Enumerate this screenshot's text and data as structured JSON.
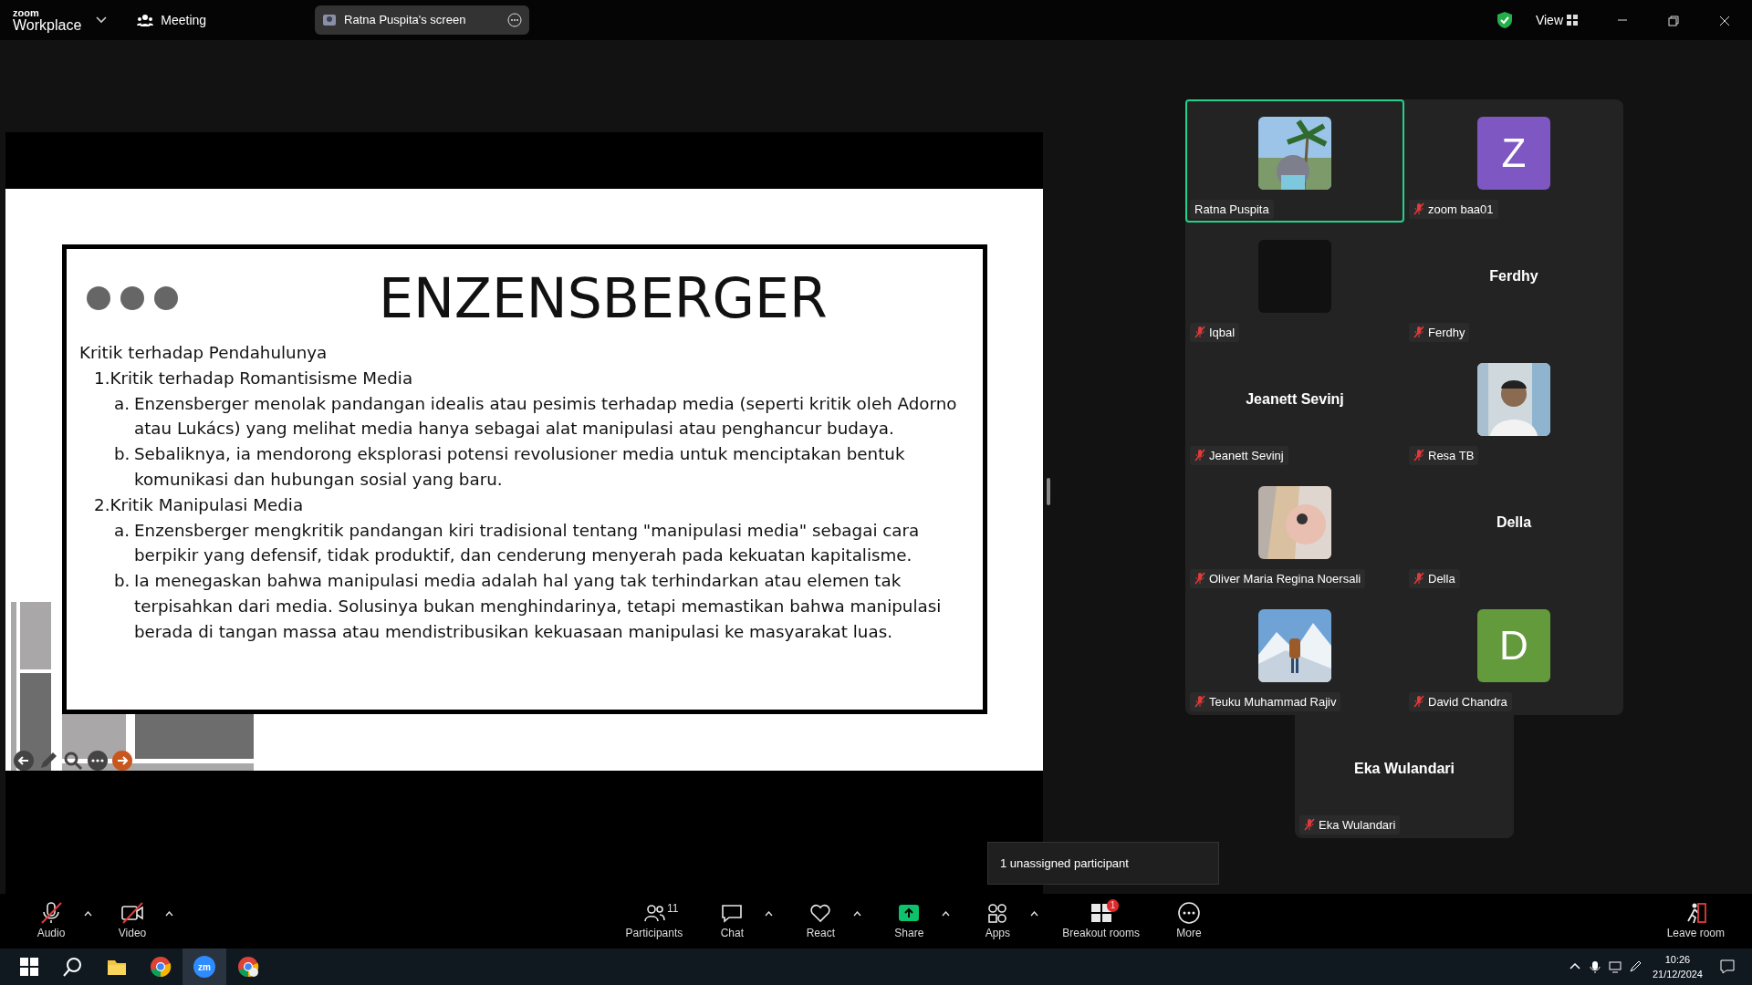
{
  "title_bar": {
    "logo_top": "zoom",
    "logo_bottom": "Workplace",
    "meeting_menu": "Meeting",
    "share_tab": "Ratna Puspita's screen",
    "view_button": "View"
  },
  "slide": {
    "title": "ENZENSBERGER",
    "intro": "Kritik terhadap Pendahulunya",
    "points": [
      {
        "label": "1.Kritik terhadap Romantisisme Media",
        "children": [
          {
            "marker": "a.",
            "text": "Enzensberger menolak pandangan idealis atau pesimis terhadap media (seperti kritik oleh Adorno atau Lukács) yang melihat media hanya sebagai alat manipulasi atau penghancur budaya."
          },
          {
            "marker": "b.",
            "text": "Sebaliknya, ia mendorong eksplorasi potensi revolusioner media untuk menciptakan bentuk komunikasi dan hubungan sosial yang baru."
          }
        ]
      },
      {
        "label": "2.Kritik Manipulasi Media",
        "children": [
          {
            "marker": "a.",
            "text": "Enzensberger mengkritik pandangan kiri tradisional tentang \"manipulasi media\" sebagai cara berpikir yang defensif, tidak produktif, dan cenderung menyerah pada kekuatan kapitalisme."
          },
          {
            "marker": "b.",
            "text": "Ia menegaskan bahwa manipulasi media adalah hal yang tak terhindarkan atau elemen tak terpisahkan dari media. Solusinya bukan menghindarinya, tetapi memastikan bahwa manipulasi berada di tangan massa atau mendistribusikan kekuasaan manipulasi ke masyarakat luas."
          }
        ]
      }
    ]
  },
  "slide_controls": [
    {
      "kind": "back",
      "highlighted": false
    },
    {
      "kind": "pen",
      "highlighted": false
    },
    {
      "kind": "zoom",
      "highlighted": false
    },
    {
      "kind": "more",
      "highlighted": false
    },
    {
      "kind": "next",
      "highlighted": true
    }
  ],
  "gallery": [
    {
      "name": "Ratna Puspita",
      "kind": "picture",
      "muted": false,
      "active": true
    },
    {
      "name": "zoom baa01",
      "kind": "letter",
      "letter": "Z",
      "color": "#7f57c2",
      "muted": true,
      "active": false
    },
    {
      "name": "Iqbal",
      "kind": "dark",
      "muted": true,
      "active": false
    },
    {
      "name": "Ferdhy",
      "kind": "name",
      "center_name": "Ferdhy",
      "muted": true,
      "active": false
    },
    {
      "name": "Jeanett Sevinj",
      "kind": "name",
      "center_name": "Jeanett Sevinj",
      "muted": true,
      "active": false
    },
    {
      "name": "Resa TB",
      "kind": "picture",
      "muted": true,
      "active": false
    },
    {
      "name": "Oliver Maria Regina Noersali",
      "kind": "picture",
      "muted": true,
      "active": false
    },
    {
      "name": "Della",
      "kind": "name",
      "center_name": "Della",
      "muted": true,
      "active": false
    },
    {
      "name": "Teuku Muhammad Rajiv",
      "kind": "picture",
      "muted": true,
      "active": false
    },
    {
      "name": "David Chandra",
      "kind": "letter",
      "letter": "D",
      "color": "#639a3c",
      "muted": true,
      "active": false
    },
    {
      "name": "Eka Wulandari",
      "kind": "name",
      "center_name": "Eka Wulandari",
      "muted": true,
      "active": false
    }
  ],
  "tooltip": "1 unassigned participant",
  "toolbar": [
    {
      "kind": "audio",
      "label": "Audio",
      "off": true,
      "has_menu": true
    },
    {
      "kind": "video",
      "label": "Video",
      "off": true,
      "has_menu": true
    },
    {
      "kind": "participants",
      "label": "Participants",
      "count": "11",
      "off": false,
      "has_menu": false
    },
    {
      "kind": "chat",
      "label": "Chat",
      "off": false,
      "has_menu": true
    },
    {
      "kind": "react",
      "label": "React",
      "off": false,
      "has_menu": true
    },
    {
      "kind": "share",
      "label": "Share",
      "off": false,
      "has_menu": true
    },
    {
      "kind": "apps",
      "label": "Apps",
      "off": false,
      "has_menu": true
    },
    {
      "kind": "breakout",
      "label": "Breakout rooms",
      "badge": "1",
      "off": false,
      "has_menu": false
    },
    {
      "kind": "more",
      "label": "More",
      "off": false,
      "has_menu": false
    },
    {
      "kind": "leave",
      "label": "Leave room",
      "off": false,
      "has_menu": false
    }
  ],
  "taskbar": {
    "apps": [
      {
        "kind": "start"
      },
      {
        "kind": "search"
      },
      {
        "kind": "folder"
      },
      {
        "kind": "chrome"
      },
      {
        "kind": "zoom",
        "text": "zm"
      },
      {
        "kind": "chrome-profile"
      }
    ],
    "time": "10:26",
    "date": "21/12/2024"
  }
}
